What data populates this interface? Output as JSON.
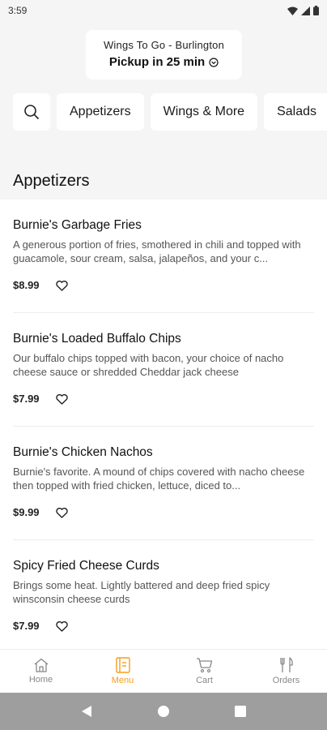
{
  "status": {
    "time": "3:59"
  },
  "header": {
    "store": "Wings To Go - Burlington",
    "pickup": "Pickup in 25 min"
  },
  "categories": [
    "Appetizers",
    "Wings & More",
    "Salads"
  ],
  "section_title": "Appetizers",
  "items": [
    {
      "name": "Burnie's Garbage Fries",
      "desc": "A generous portion of fries, smothered in chili and topped with guacamole, sour cream, salsa, jalapeños, and your c...",
      "price": "$8.99"
    },
    {
      "name": "Burnie's Loaded Buffalo Chips",
      "desc": "Our buffalo chips topped with bacon, your choice of nacho cheese sauce or shredded Cheddar jack cheese",
      "price": "$7.99"
    },
    {
      "name": "Burnie's Chicken Nachos",
      "desc": "Burnie's favorite. A mound of chips covered with nacho cheese then topped with fried chicken, lettuce, diced to...",
      "price": "$9.99"
    },
    {
      "name": "Spicy Fried Cheese Curds",
      "desc": "Brings some heat. Lightly battered and deep fried spicy winsconsin cheese curds",
      "price": "$7.99"
    }
  ],
  "nav": [
    {
      "label": "Home",
      "icon": "home-icon"
    },
    {
      "label": "Menu",
      "icon": "menu-icon"
    },
    {
      "label": "Cart",
      "icon": "cart-icon"
    },
    {
      "label": "Orders",
      "icon": "orders-icon"
    }
  ],
  "colors": {
    "accent": "#f59e1b",
    "background": "#f5f5f5"
  }
}
